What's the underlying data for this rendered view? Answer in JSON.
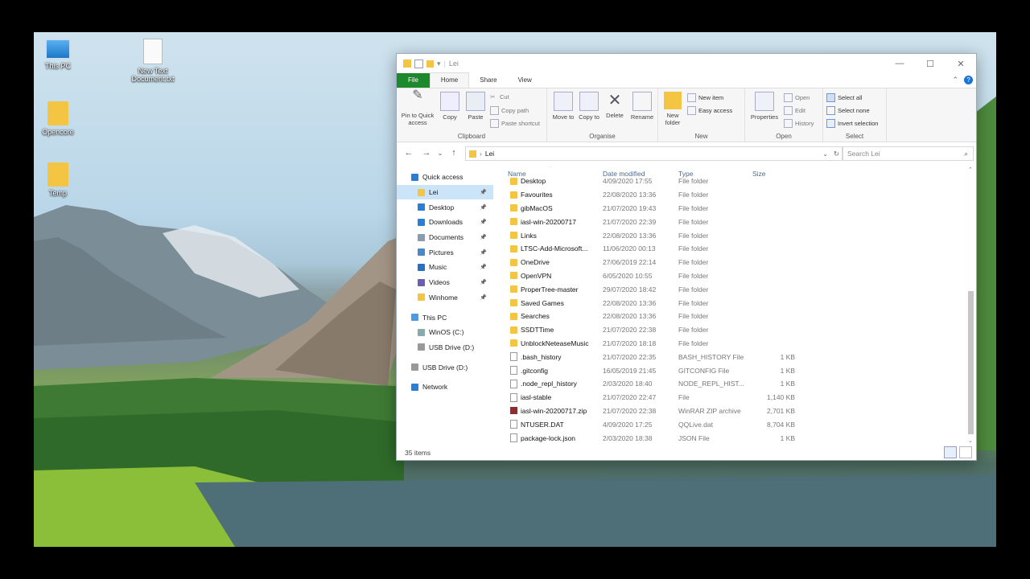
{
  "desktop": {
    "icons": [
      {
        "label": "This PC"
      },
      {
        "label": "New Text Document.txt"
      },
      {
        "label": "Opencore"
      },
      {
        "label": "Temp"
      }
    ]
  },
  "window": {
    "title": "Lei",
    "tabs": [
      "File",
      "Home",
      "Share",
      "View"
    ],
    "ribbon": {
      "clipboard": {
        "label": "Clipboard",
        "pin": "Pin to Quick access",
        "copy": "Copy",
        "paste": "Paste",
        "cut": "Cut",
        "copy_path": "Copy path",
        "paste_shortcut": "Paste shortcut"
      },
      "organise": {
        "label": "Organise",
        "move_to": "Move to",
        "copy_to": "Copy to",
        "delete": "Delete",
        "rename": "Rename"
      },
      "new": {
        "label": "New",
        "new_folder": "New folder",
        "new_item": "New item",
        "easy_access": "Easy access"
      },
      "open": {
        "label": "Open",
        "properties": "Properties",
        "open": "Open",
        "edit": "Edit",
        "history": "History"
      },
      "select": {
        "label": "Select",
        "select_all": "Select all",
        "select_none": "Select none",
        "invert": "Invert selection"
      }
    },
    "address": {
      "path": "Lei",
      "search_placeholder": "Search Lei"
    },
    "nav": [
      {
        "label": "Quick access",
        "pinned": false,
        "icon": "star-icon",
        "level": 0
      },
      {
        "label": "Lei",
        "pinned": true,
        "icon": "folder-icon",
        "level": 1,
        "selected": true
      },
      {
        "label": "Desktop",
        "pinned": true,
        "icon": "desktop-icon",
        "level": 1
      },
      {
        "label": "Downloads",
        "pinned": true,
        "icon": "download-icon",
        "level": 1
      },
      {
        "label": "Documents",
        "pinned": true,
        "icon": "documents-icon",
        "level": 1
      },
      {
        "label": "Pictures",
        "pinned": true,
        "icon": "pictures-icon",
        "level": 1
      },
      {
        "label": "Music",
        "pinned": true,
        "icon": "music-icon",
        "level": 1
      },
      {
        "label": "Videos",
        "pinned": true,
        "icon": "videos-icon",
        "level": 1
      },
      {
        "label": "Winhome",
        "pinned": true,
        "icon": "folder-icon",
        "level": 1
      },
      {
        "label": "",
        "spacer": true
      },
      {
        "label": "This PC",
        "pinned": false,
        "icon": "pc-icon",
        "level": 0
      },
      {
        "label": "WinOS (C:)",
        "pinned": false,
        "icon": "drive-icon",
        "level": 1
      },
      {
        "label": "USB Drive (D:)",
        "pinned": false,
        "icon": "usb-icon",
        "level": 1
      },
      {
        "label": "",
        "spacer": true
      },
      {
        "label": "USB Drive (D:)",
        "pinned": false,
        "icon": "usb-icon",
        "level": 0
      },
      {
        "label": "",
        "spacer": true
      },
      {
        "label": "Network",
        "pinned": false,
        "icon": "network-icon",
        "level": 0
      }
    ],
    "columns": {
      "name": "Name",
      "date": "Date modified",
      "type": "Type",
      "size": "Size"
    },
    "files": [
      {
        "name": "Desktop",
        "date": "4/09/2020 17:55",
        "type": "File folder",
        "size": "",
        "icon": "folder"
      },
      {
        "name": "Favourites",
        "date": "22/08/2020 13:36",
        "type": "File folder",
        "size": "",
        "icon": "folder"
      },
      {
        "name": "gibMacOS",
        "date": "21/07/2020 19:43",
        "type": "File folder",
        "size": "",
        "icon": "folder"
      },
      {
        "name": "iasl-win-20200717",
        "date": "21/07/2020 22:39",
        "type": "File folder",
        "size": "",
        "icon": "folder"
      },
      {
        "name": "Links",
        "date": "22/08/2020 13:36",
        "type": "File folder",
        "size": "",
        "icon": "folder"
      },
      {
        "name": "LTSC-Add-Microsoft...",
        "date": "11/06/2020 00:13",
        "type": "File folder",
        "size": "",
        "icon": "folder"
      },
      {
        "name": "OneDrive",
        "date": "27/06/2019 22:14",
        "type": "File folder",
        "size": "",
        "icon": "folder"
      },
      {
        "name": "OpenVPN",
        "date": "6/05/2020 10:55",
        "type": "File folder",
        "size": "",
        "icon": "folder"
      },
      {
        "name": "ProperTree-master",
        "date": "29/07/2020 18:42",
        "type": "File folder",
        "size": "",
        "icon": "folder"
      },
      {
        "name": "Saved Games",
        "date": "22/08/2020 13:36",
        "type": "File folder",
        "size": "",
        "icon": "folder"
      },
      {
        "name": "Searches",
        "date": "22/08/2020 13:36",
        "type": "File folder",
        "size": "",
        "icon": "folder"
      },
      {
        "name": "SSDTTime",
        "date": "21/07/2020 22:38",
        "type": "File folder",
        "size": "",
        "icon": "folder"
      },
      {
        "name": "UnblockNeteaseMusic",
        "date": "21/07/2020 18:18",
        "type": "File folder",
        "size": "",
        "icon": "folder"
      },
      {
        "name": ".bash_history",
        "date": "21/07/2020 22:35",
        "type": "BASH_HISTORY File",
        "size": "1 KB",
        "icon": "doc"
      },
      {
        "name": ".gitconfig",
        "date": "16/05/2019 21:45",
        "type": "GITCONFIG File",
        "size": "1 KB",
        "icon": "doc"
      },
      {
        "name": ".node_repl_history",
        "date": "2/03/2020 18:40",
        "type": "NODE_REPL_HIST...",
        "size": "1 KB",
        "icon": "doc"
      },
      {
        "name": "iasl-stable",
        "date": "21/07/2020 22:47",
        "type": "File",
        "size": "1,140 KB",
        "icon": "doc"
      },
      {
        "name": "iasl-win-20200717.zip",
        "date": "21/07/2020 22:38",
        "type": "WinRAR ZIP archive",
        "size": "2,701 KB",
        "icon": "zip"
      },
      {
        "name": "NTUSER.DAT",
        "date": "4/09/2020 17:25",
        "type": "QQLive.dat",
        "size": "8,704 KB",
        "icon": "doc"
      },
      {
        "name": "package-lock.json",
        "date": "2/03/2020 18:38",
        "type": "JSON File",
        "size": "1 KB",
        "icon": "doc"
      }
    ],
    "status": "35 items"
  }
}
